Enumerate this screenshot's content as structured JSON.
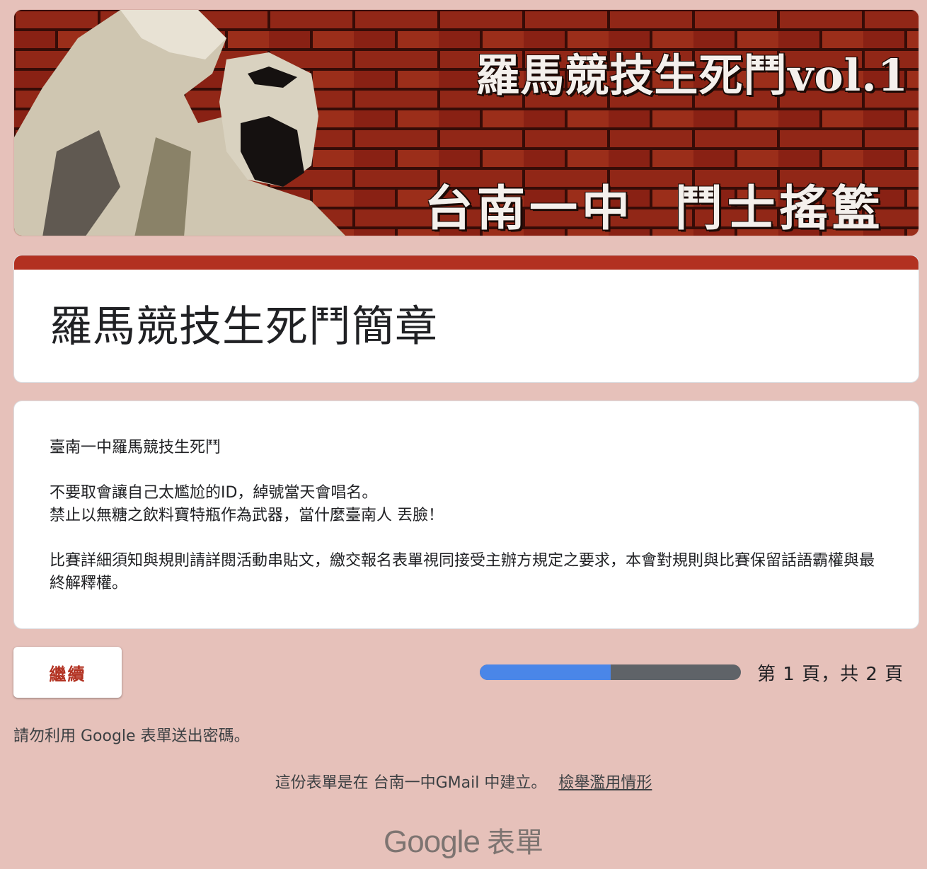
{
  "banner": {
    "title": "羅馬競技生死鬥vol.1",
    "subtitle": "台南一中 鬥士搖籃"
  },
  "form": {
    "title": "羅馬競技生死鬥簡章",
    "description": [
      "臺南一中羅馬競技生死鬥",
      "",
      "不要取會讓自己太尷尬的ID，綽號當天會唱名。",
      "禁止以無糖之飲料寶特瓶作為武器，當什麼臺南人 丟臉！",
      "",
      "比賽詳細須知與規則請詳閱活動串貼文，繳交報名表單視同接受主辦方規定之要求，本會對規則與比賽保留話語霸權與最終解釋權。"
    ]
  },
  "navigation": {
    "continue_label": "繼續",
    "progress_fraction": 0.5,
    "page_indicator": "第 1 頁，共 2 頁"
  },
  "footer": {
    "no_password": "請勿利用 Google 表單送出密碼。",
    "created_text": "這份表單是在 台南一中GMail 中建立。",
    "report_link": "檢舉濫用情形",
    "logo_google": "Google",
    "logo_forms": "表單"
  },
  "colors": {
    "background": "#e6c1ba",
    "accent": "#b23121",
    "progress_fill": "#4a86e8",
    "progress_track": "#5f6368"
  }
}
